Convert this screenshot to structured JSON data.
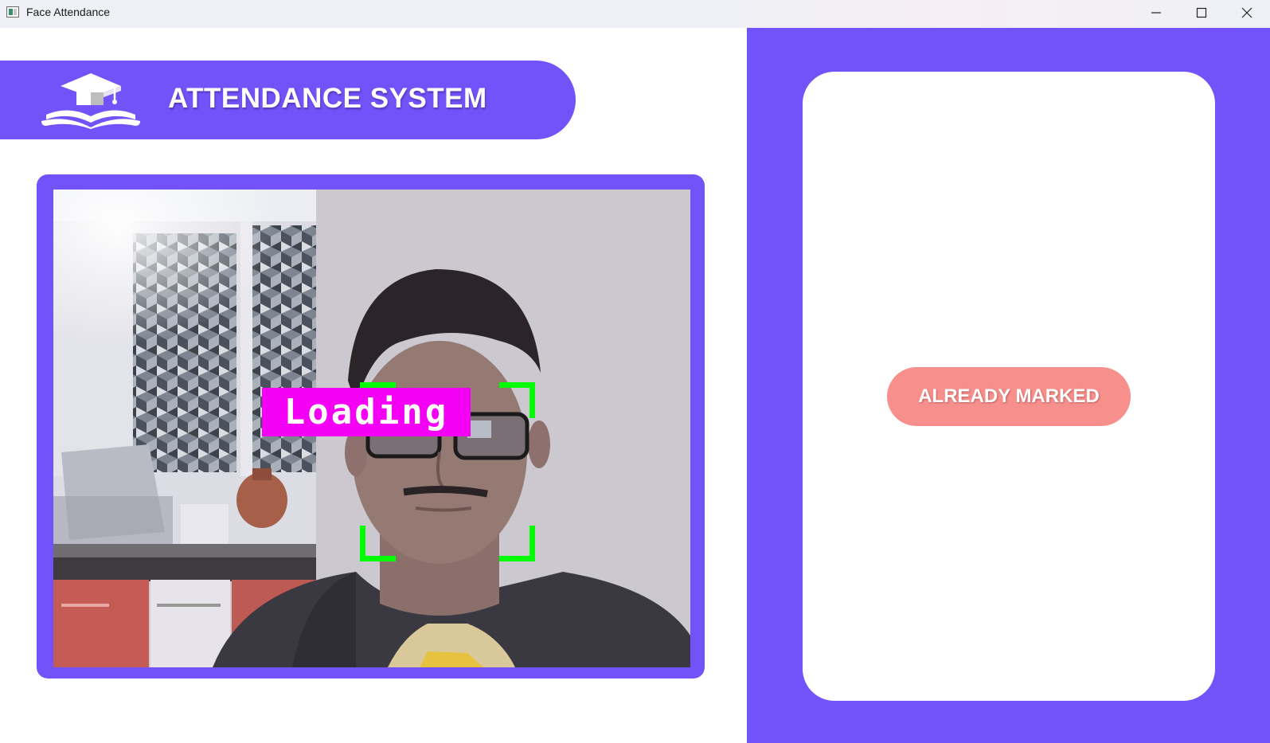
{
  "window": {
    "title": "Face Attendance",
    "controls": [
      "minimize",
      "maximize",
      "close"
    ]
  },
  "header": {
    "title": "ATTENDANCE SYSTEM",
    "logo_icon": "graduation-cap-book-icon"
  },
  "camera": {
    "overlay_label": "Loading",
    "label_color": "#f400f4",
    "face_box_color": "#00ff00"
  },
  "status": {
    "label": "ALREADY MARKED",
    "color": "#f7908c"
  },
  "colors": {
    "accent": "#7253f9",
    "card": "#ffffff"
  }
}
